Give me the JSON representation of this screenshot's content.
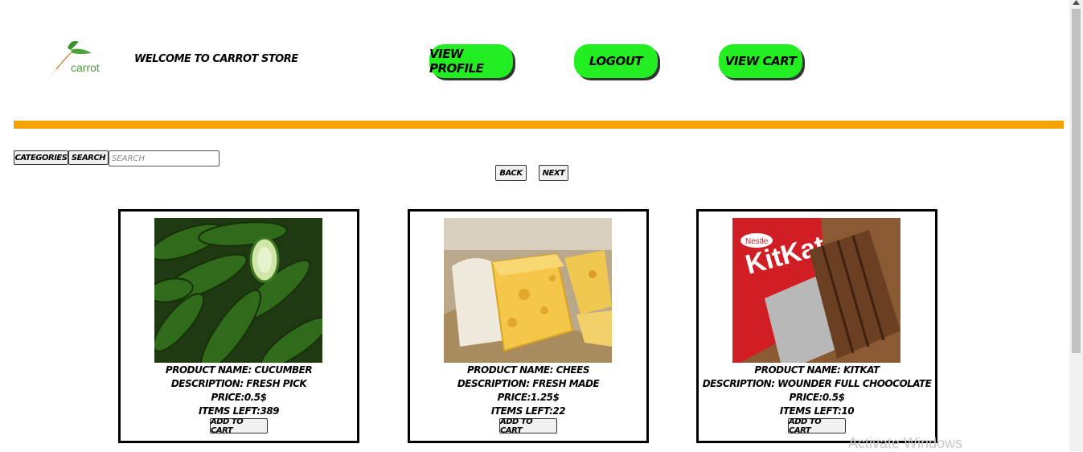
{
  "header": {
    "logo_text": "carrot",
    "welcome": "WELCOME TO CARROT STORE",
    "view_profile_label": "VIEW PROFILE",
    "logout_label": "LOGOUT",
    "view_cart_label": "VIEW CART",
    "button_color": "#22ee22"
  },
  "accent_bar_color": "#f5a300",
  "toolbar": {
    "categories_label": "CATEGORIES",
    "search_label": "SEARCH",
    "search_placeholder": "SEARCH",
    "search_value": ""
  },
  "pagination": {
    "back_label": "BACK",
    "next_label": "NEXT"
  },
  "products": [
    {
      "image_icon": "cucumber-image",
      "name": "PRODUCT NAME: CUCUMBER",
      "description": "DESCRIPTION: FRESH PICK",
      "price": "PRICE:0.5$",
      "items_left": "ITEMS LEFT:389",
      "add_label": "ADD TO CART"
    },
    {
      "image_icon": "cheese-image",
      "name": "PRODUCT NAME: CHEES",
      "description": "DESCRIPTION: FRESH MADE",
      "price": "PRICE:1.25$",
      "items_left": "ITEMS LEFT:22",
      "add_label": "ADD TO CART"
    },
    {
      "image_icon": "kitkat-image",
      "name": "PRODUCT NAME: KITKAT",
      "description": "DESCRIPTION: WOUNDER FULL CHOOCOLATE",
      "price": "PRICE:0.5$",
      "items_left": "ITEMS LEFT:10",
      "add_label": "ADD TO CART",
      "brand_text": "KitKat",
      "maker_text": "Nestle"
    }
  ],
  "watermark": "Activate Windows"
}
